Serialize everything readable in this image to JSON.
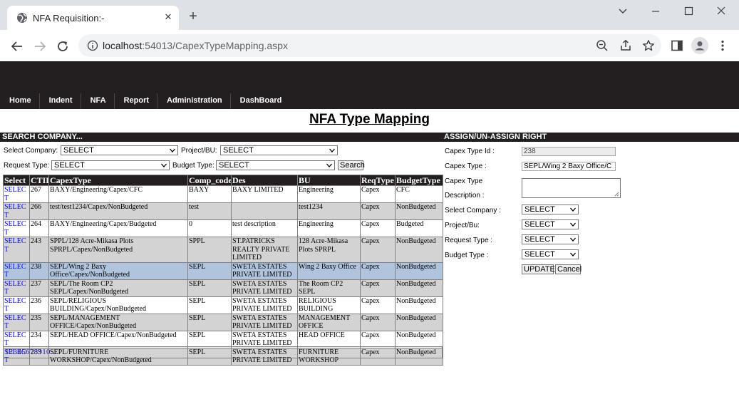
{
  "browser": {
    "tab_title": "NFA Requisition:-",
    "url_host": "localhost",
    "url_rest": ":54013/CapexTypeMapping.aspx"
  },
  "menu": [
    "Home",
    "Indent",
    "NFA",
    "Report",
    "Administration",
    "DashBoard"
  ],
  "page_title": "NFA Type Mapping",
  "search": {
    "section_title": "SEARCH COMPANY...",
    "company_label": "Select Company:",
    "company_value": "SELECT",
    "project_label": "Project/BU:",
    "project_value": "SELECT",
    "request_label": "Request Type:",
    "request_value": "SELECT",
    "budget_label": "Budget Type:",
    "budget_value": "SELECT",
    "search_button": "Search"
  },
  "grid": {
    "headers": [
      "Select",
      "CTID",
      "CapexType",
      "Comp_code",
      "Des",
      "BU",
      "ReqType",
      "BudgetType"
    ],
    "select_text": "SELECT",
    "rows": [
      {
        "ctid": "267",
        "capex": "BAXY/Engineering/Capex/CFC",
        "comp": "BAXY",
        "des": "BAXY LIMITED",
        "bu": "Engineering",
        "req": "Capex",
        "budget": "CFC"
      },
      {
        "ctid": "266",
        "capex": "test/test1234/Capex/NonBudgeted",
        "comp": "test",
        "des": "",
        "bu": "test1234",
        "req": "Capex",
        "budget": "NonBudgeted"
      },
      {
        "ctid": "264",
        "capex": "BAXY/Engineering/Capex/Budgeted",
        "comp": "0",
        "des": "test description",
        "bu": "Engineering",
        "req": "Capex",
        "budget": "Budgeted"
      },
      {
        "ctid": "243",
        "capex": "SPPL/128 Acre-Mikasa Plots SPRPL/Capex/NonBudgeted",
        "comp": "SPPL",
        "des": "ST.PATRICKS REALTY PRIVATE LIMITED",
        "bu": "128 Acre-Mikasa Plots SPRPL",
        "req": "Capex",
        "budget": "NonBudgeted"
      },
      {
        "ctid": "238",
        "capex": "SEPL/Wing 2 Baxy Office/Capex/NonBudgeted",
        "comp": "SEPL",
        "des": "SWETA ESTATES PRIVATE LIMITED",
        "bu": "Wing 2 Baxy Office",
        "req": "Capex",
        "budget": "NonBudgeted"
      },
      {
        "ctid": "237",
        "capex": "SEPL/The Room CP2 SEPL/Capex/NonBudgeted",
        "comp": "SEPL",
        "des": "SWETA ESTATES PRIVATE LIMITED",
        "bu": "The Room CP2 SEPL",
        "req": "Capex",
        "budget": "NonBudgeted"
      },
      {
        "ctid": "236",
        "capex": "SEPL/RELIGIOUS BUILDING/Capex/NonBudgeted",
        "comp": "SEPL",
        "des": "SWETA ESTATES PRIVATE LIMITED",
        "bu": "RELIGIOUS BUILDING",
        "req": "Capex",
        "budget": "NonBudgeted"
      },
      {
        "ctid": "235",
        "capex": "SEPL/MANAGEMENT OFFICE/Capex/NonBudgeted",
        "comp": "SEPL",
        "des": "SWETA ESTATES PRIVATE LIMITED",
        "bu": "MANAGEMENT OFFICE",
        "req": "Capex",
        "budget": "NonBudgeted"
      },
      {
        "ctid": "234",
        "capex": "SEPL/HEAD OFFICE/Capex/NonBudgeted",
        "comp": "SEPL",
        "des": "SWETA ESTATES PRIVATE LIMITED",
        "bu": "HEAD OFFICE",
        "req": "Capex",
        "budget": "NonBudgeted"
      },
      {
        "ctid": "233",
        "capex": "SEPL/FURNITURE WORKSHOP/Capex/NonBudgeted",
        "comp": "SEPL",
        "des": "SWETA ESTATES PRIVATE LIMITED",
        "bu": "FURNITURE WORKSHOP",
        "req": "Capex",
        "budget": "NonBudgeted"
      }
    ],
    "pager": "12345678910..."
  },
  "assign": {
    "section_title": "ASSIGN/UN-ASSIGN RIGHT",
    "capex_id_label": "Capex Type Id :",
    "capex_id_value": "238",
    "capex_type_label": "Capex Type :",
    "capex_type_value": "SEPL/Wing 2 Baxy Office/C",
    "desc_label_1": "Capex Type",
    "desc_label_2": "Description :",
    "company_label": "Select Company :",
    "company_value": "SELECT",
    "project_label": "Project/Bu:",
    "project_value": "SELECT",
    "request_label": "Request Type :",
    "request_value": "SELECT",
    "budget_label": "Budget Type :",
    "budget_value": "SELECT",
    "update_button": "UPDATE",
    "cancel_button": "Cancel"
  },
  "colors": {
    "header_dark": "#231f20",
    "row_gray": "#d3d3d3",
    "row_selected": "#b0c4de",
    "link_blue": "#0000ee"
  }
}
